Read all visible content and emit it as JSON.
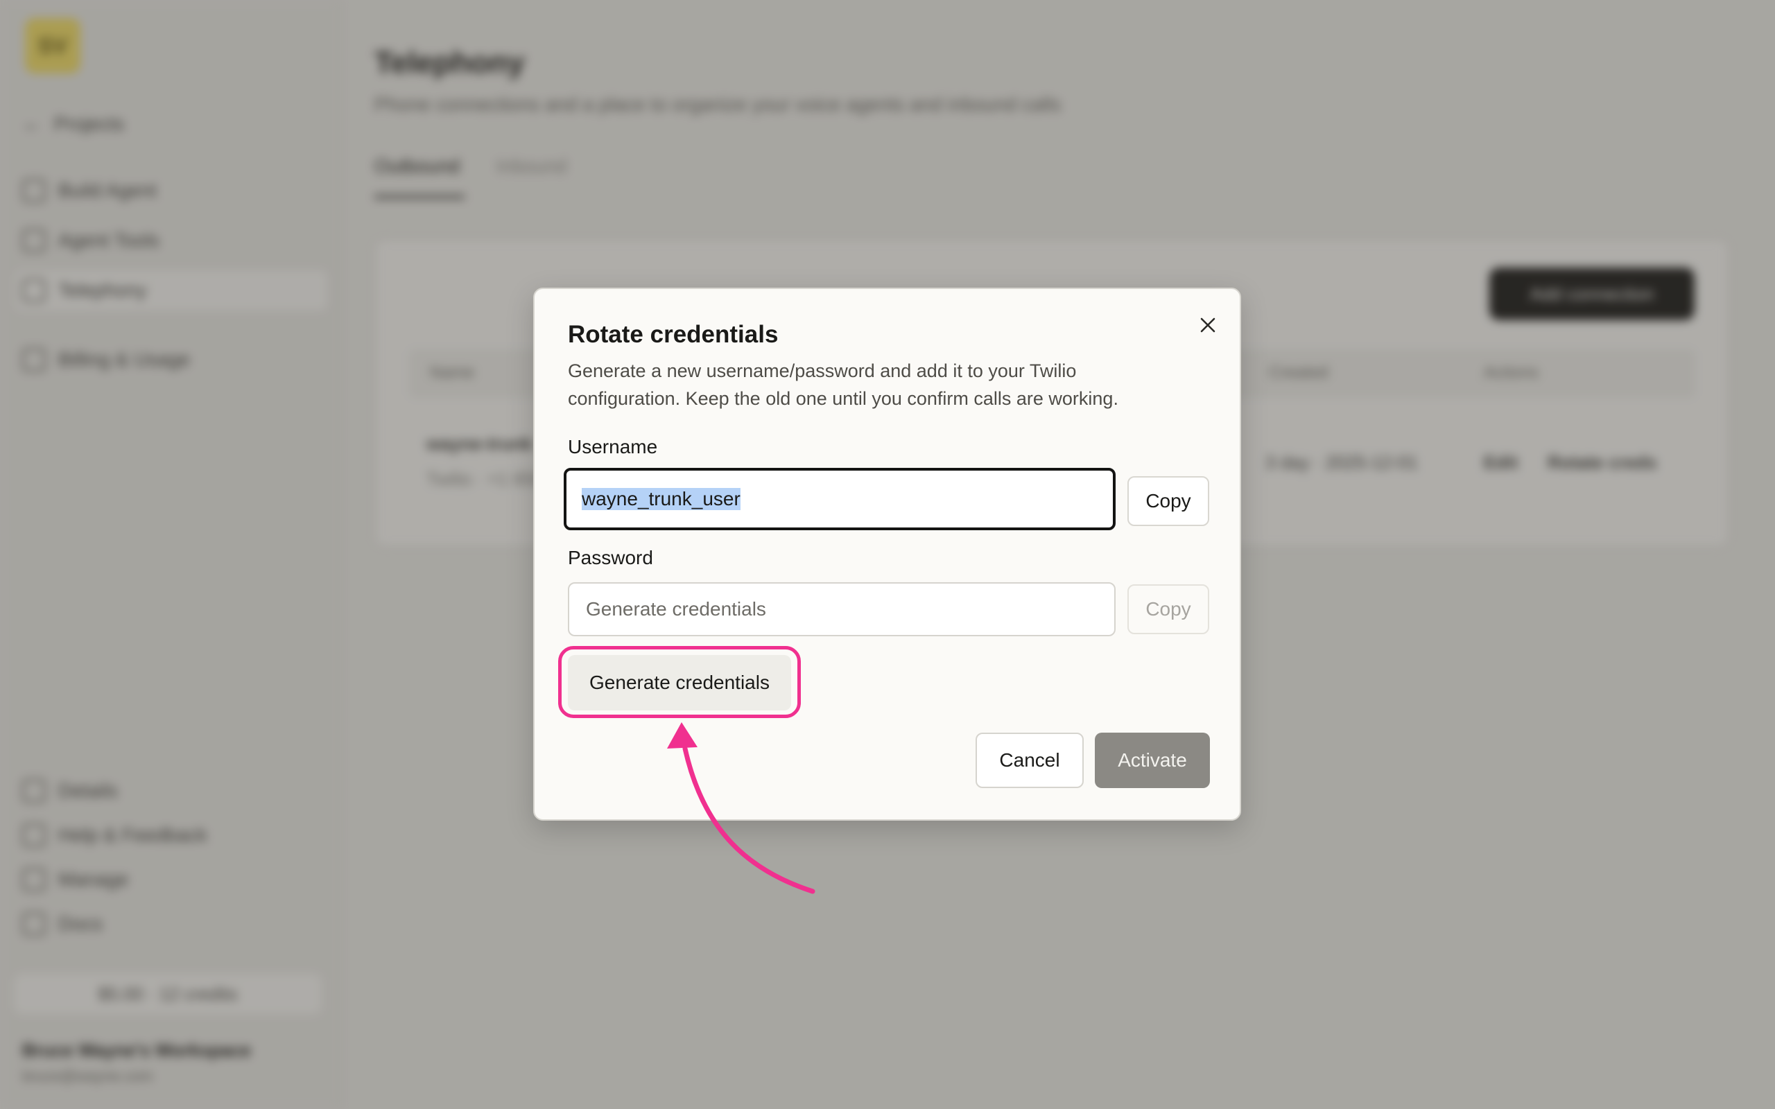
{
  "background": {
    "logo_text": "SV",
    "back_label": "Projects",
    "nav": [
      {
        "label": "Build Agent",
        "icon": "agent-icon"
      },
      {
        "label": "Agent Tools",
        "icon": "tools-icon"
      },
      {
        "label": "Telephony",
        "icon": "phone-icon"
      },
      {
        "label": "Billing & Usage",
        "icon": "chart-icon"
      }
    ],
    "footer_nav": [
      {
        "label": "Details",
        "icon": "info-icon"
      },
      {
        "label": "Help & Feedback",
        "icon": "help-icon"
      },
      {
        "label": "Manage",
        "icon": "settings-icon"
      },
      {
        "label": "Docs",
        "icon": "docs-icon"
      }
    ],
    "upgrade_label": "$5.00 · 12 credits",
    "workspace_name": "Bruce Wayne's Workspace",
    "workspace_sub": "bruce@wayne.com",
    "page_title": "Telephony",
    "page_subtitle": "Phone connections and a place to organize your voice agents and inbound calls",
    "tabs": [
      "Outbound",
      "Inbound"
    ],
    "new_button": "Add connection",
    "table_headers": [
      "Name",
      "Created",
      "Actions"
    ],
    "table_row": {
      "name": "wayne-trunk",
      "detail": "Twilio · +1 650",
      "created": "3 day · 2025-12-01",
      "action_1": "Edit",
      "action_2": "Rotate creds"
    }
  },
  "modal": {
    "title": "Rotate credentials",
    "description": "Generate a new username/password and add it to your Twilio configuration. Keep the old one until you confirm calls are working.",
    "username_label": "Username",
    "username_value": "wayne_trunk_user",
    "password_label": "Password",
    "password_placeholder": "Generate credentials",
    "copy_label": "Copy",
    "generate_label": "Generate credentials",
    "cancel_label": "Cancel",
    "activate_label": "Activate"
  },
  "colors": {
    "highlight": "#f0308f",
    "activate_disabled": "#8b8984",
    "selection": "#b5d2f7"
  }
}
